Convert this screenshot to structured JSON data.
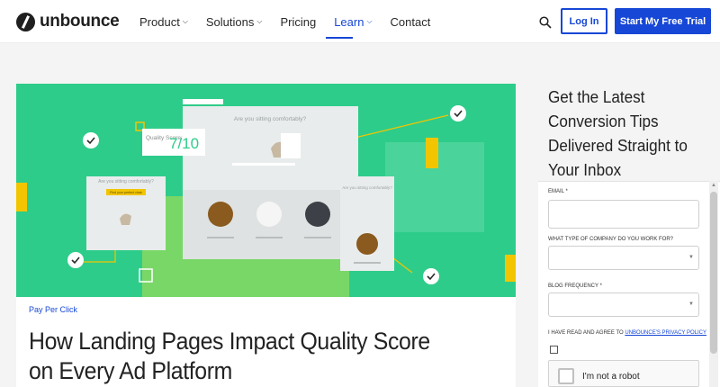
{
  "header": {
    "logo_text": "unbounce",
    "nav": [
      {
        "label": "Product",
        "chevron": true
      },
      {
        "label": "Solutions",
        "chevron": true
      },
      {
        "label": "Pricing",
        "chevron": false
      },
      {
        "label": "Learn",
        "chevron": true,
        "active": true
      },
      {
        "label": "Contact",
        "chevron": false
      }
    ],
    "login_label": "Log In",
    "trial_label": "Start My Free Trial",
    "search_icon": "search-icon"
  },
  "hero": {
    "mock_heading_main": "Are you sitting comfortably?",
    "mock_heading_left": "Are you sitting comfortably?",
    "mock_heading_right": "Are you sitting comfortably?",
    "mock_button": "Find your perfect chair",
    "quality_label": "Quality Score:",
    "quality_value": "7/10"
  },
  "article": {
    "category": "Pay Per Click",
    "title": "How Landing Pages Impact Quality Score on Every Ad Platform"
  },
  "sidebar": {
    "title": "Get the Latest Conversion Tips Delivered Straight to Your Inbox",
    "form": {
      "email_label": "EMAIL *",
      "company_label": "WHAT TYPE OF COMPANY DO YOU WORK FOR?",
      "frequency_label": "BLOG FREQUENCY *",
      "agree_prefix": "I HAVE READ AND AGREE TO ",
      "agree_link": "UNBOUNCE'S PRIVACY POLICY",
      "captcha_label": "I'm not a robot"
    }
  },
  "colors": {
    "brand_blue": "#1747d6",
    "hero_green": "#2ecc8a",
    "accent_yellow": "#f2c500"
  }
}
